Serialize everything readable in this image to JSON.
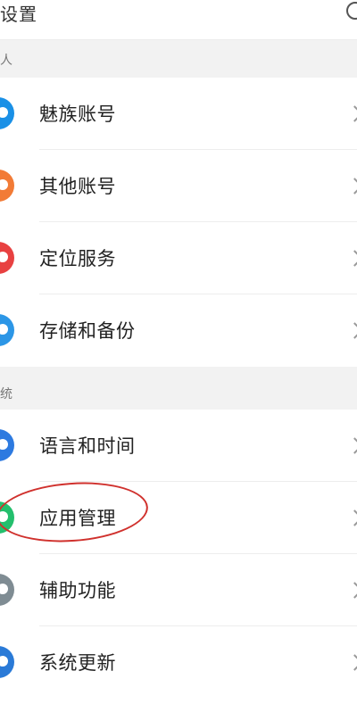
{
  "header": {
    "title": "设置"
  },
  "sections": [
    {
      "label": "人",
      "items": [
        {
          "label": "魅族账号",
          "icon": "flyme-account-icon",
          "color": "#1a90e6"
        },
        {
          "label": "其他账号",
          "icon": "user-icon",
          "color": "#f27b36"
        },
        {
          "label": "定位服务",
          "icon": "location-pin-icon",
          "color": "#e84141"
        },
        {
          "label": "存储和备份",
          "icon": "cloud-icon",
          "color": "#2c96e6"
        }
      ]
    },
    {
      "label": "统",
      "items": [
        {
          "label": "语言和时间",
          "icon": "globe-icon",
          "color": "#2d7ae0"
        },
        {
          "label": "应用管理",
          "icon": "app-management-icon",
          "color": "#24bf6d"
        },
        {
          "label": "辅助功能",
          "icon": "accessibility-icon",
          "color": "#7f8c93"
        },
        {
          "label": "系统更新",
          "icon": "system-update-icon",
          "color": "#2a7ad7"
        }
      ]
    }
  ]
}
